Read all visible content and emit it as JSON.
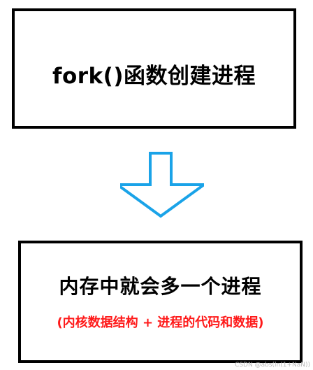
{
  "top_box": {
    "title": "fork()函数创建进程"
  },
  "bottom_box": {
    "title": "内存中就会多一个进程",
    "subtitle": "(内核数据结构 + 进程的代码和数据)"
  },
  "arrow": {
    "icon": "down-arrow-icon",
    "color": "#1aa3e8"
  },
  "watermark": {
    "text": "CSDN @abs(ln(1+NaN))"
  },
  "colors": {
    "subtitle": "#ff1a1a",
    "border": "#000000"
  }
}
